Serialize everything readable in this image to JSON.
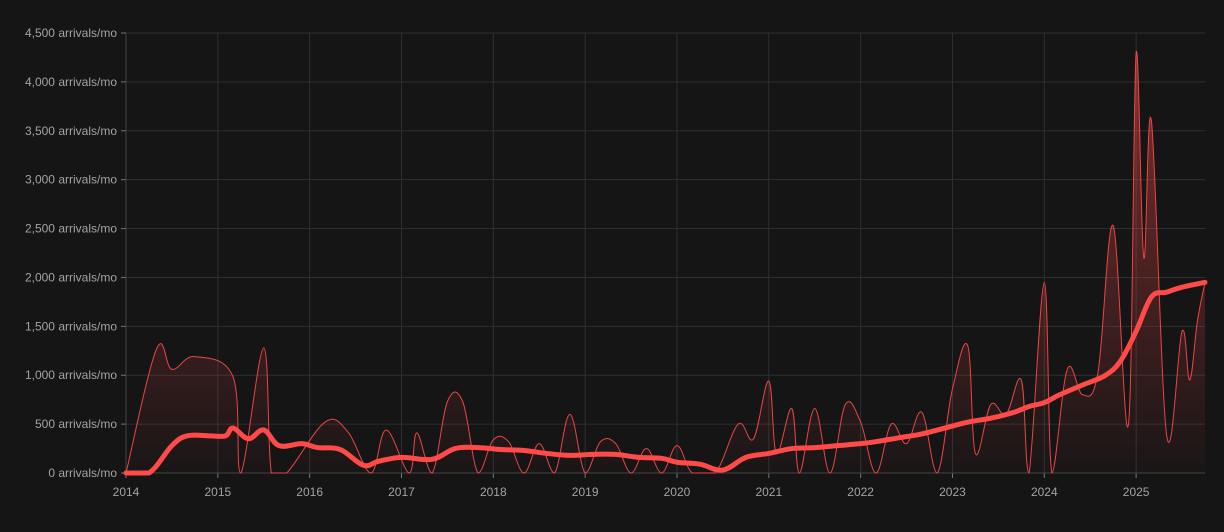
{
  "chart_data": {
    "type": "line",
    "ylabel_unit": "arrivals/mo",
    "ylim": [
      0,
      4500
    ],
    "xlim": [
      "2014-01",
      "2025-10"
    ],
    "grid": true,
    "colors": {
      "background": "#151515",
      "grid": "#2e2f33",
      "line": "#ff4a4a",
      "area_fill": "#ff4a4a"
    },
    "y_ticks": [
      {
        "value": 0,
        "label": "0 arrivals/mo"
      },
      {
        "value": 500,
        "label": "500 arrivals/mo"
      },
      {
        "value": 1000,
        "label": "1,000 arrivals/mo"
      },
      {
        "value": 1500,
        "label": "1,500 arrivals/mo"
      },
      {
        "value": 2000,
        "label": "2,000 arrivals/mo"
      },
      {
        "value": 2500,
        "label": "2,500 arrivals/mo"
      },
      {
        "value": 3000,
        "label": "3,000 arrivals/mo"
      },
      {
        "value": 3500,
        "label": "3,500 arrivals/mo"
      },
      {
        "value": 4000,
        "label": "4,000 arrivals/mo"
      },
      {
        "value": 4500,
        "label": "4,500 arrivals/mo"
      }
    ],
    "x_ticks": [
      "2014",
      "2015",
      "2016",
      "2017",
      "2018",
      "2019",
      "2020",
      "2021",
      "2022",
      "2023",
      "2024",
      "2025"
    ],
    "series": [
      {
        "style": "thin-with-area",
        "x": [
          "2014-01",
          "2014-05",
          "2014-07",
          "2014-10",
          "2015-03",
          "2015-04",
          "2015-07",
          "2015-08",
          "2015-10",
          "2016-03",
          "2016-06",
          "2016-09",
          "2016-11",
          "2017-02",
          "2017-03",
          "2017-05",
          "2017-07",
          "2017-09",
          "2017-11",
          "2018-01",
          "2018-03",
          "2018-05",
          "2018-07",
          "2018-09",
          "2018-11",
          "2019-01",
          "2019-03",
          "2019-05",
          "2019-07",
          "2019-09",
          "2019-11",
          "2020-01",
          "2020-03",
          "2020-06",
          "2020-09",
          "2020-11",
          "2021-01",
          "2021-02",
          "2021-04",
          "2021-05",
          "2021-07",
          "2021-09",
          "2021-11",
          "2022-01",
          "2022-03",
          "2022-05",
          "2022-07",
          "2022-09",
          "2022-11",
          "2023-01",
          "2023-03",
          "2023-04",
          "2023-06",
          "2023-08",
          "2023-10",
          "2023-11",
          "2024-01",
          "2024-02",
          "2024-04",
          "2024-06",
          "2024-08",
          "2024-10",
          "2024-12",
          "2025-01",
          "2025-02",
          "2025-03",
          "2025-05",
          "2025-07",
          "2025-08",
          "2025-09",
          "2025-10"
        ],
        "values": [
          0,
          1270,
          1060,
          1190,
          980,
          0,
          1280,
          0,
          0,
          520,
          420,
          0,
          440,
          0,
          410,
          0,
          730,
          730,
          0,
          340,
          320,
          0,
          300,
          0,
          600,
          0,
          320,
          300,
          0,
          250,
          0,
          280,
          0,
          0,
          500,
          350,
          940,
          200,
          660,
          0,
          660,
          0,
          700,
          520,
          0,
          500,
          300,
          620,
          0,
          860,
          1300,
          200,
          700,
          600,
          950,
          0,
          1950,
          0,
          1060,
          800,
          1020,
          2530,
          500,
          4300,
          2200,
          3600,
          380,
          1450,
          950,
          1550,
          1950
        ]
      },
      {
        "style": "thick",
        "x": [
          "2014-01",
          "2014-04",
          "2014-07",
          "2014-09",
          "2014-12",
          "2015-02",
          "2015-03",
          "2015-05",
          "2015-07",
          "2015-09",
          "2015-12",
          "2016-02",
          "2016-05",
          "2016-08",
          "2016-10",
          "2017-01",
          "2017-05",
          "2017-08",
          "2017-11",
          "2018-02",
          "2018-05",
          "2018-08",
          "2018-11",
          "2019-02",
          "2019-05",
          "2019-08",
          "2019-11",
          "2020-01",
          "2020-04",
          "2020-07",
          "2020-10",
          "2021-01",
          "2021-04",
          "2021-07",
          "2021-10",
          "2022-01",
          "2022-03",
          "2022-06",
          "2022-09",
          "2022-12",
          "2023-03",
          "2023-06",
          "2023-09",
          "2023-11",
          "2024-01",
          "2024-03",
          "2024-06",
          "2024-09",
          "2024-11",
          "2025-01",
          "2025-03",
          "2025-05",
          "2025-07",
          "2025-10"
        ],
        "values": [
          0,
          0,
          280,
          380,
          380,
          380,
          460,
          350,
          440,
          280,
          300,
          260,
          240,
          80,
          120,
          160,
          140,
          250,
          260,
          240,
          230,
          200,
          180,
          190,
          190,
          160,
          150,
          110,
          90,
          30,
          160,
          200,
          250,
          260,
          280,
          300,
          320,
          360,
          400,
          460,
          520,
          560,
          620,
          680,
          720,
          800,
          900,
          1000,
          1150,
          1450,
          1800,
          1850,
          1900,
          1950
        ]
      }
    ]
  }
}
